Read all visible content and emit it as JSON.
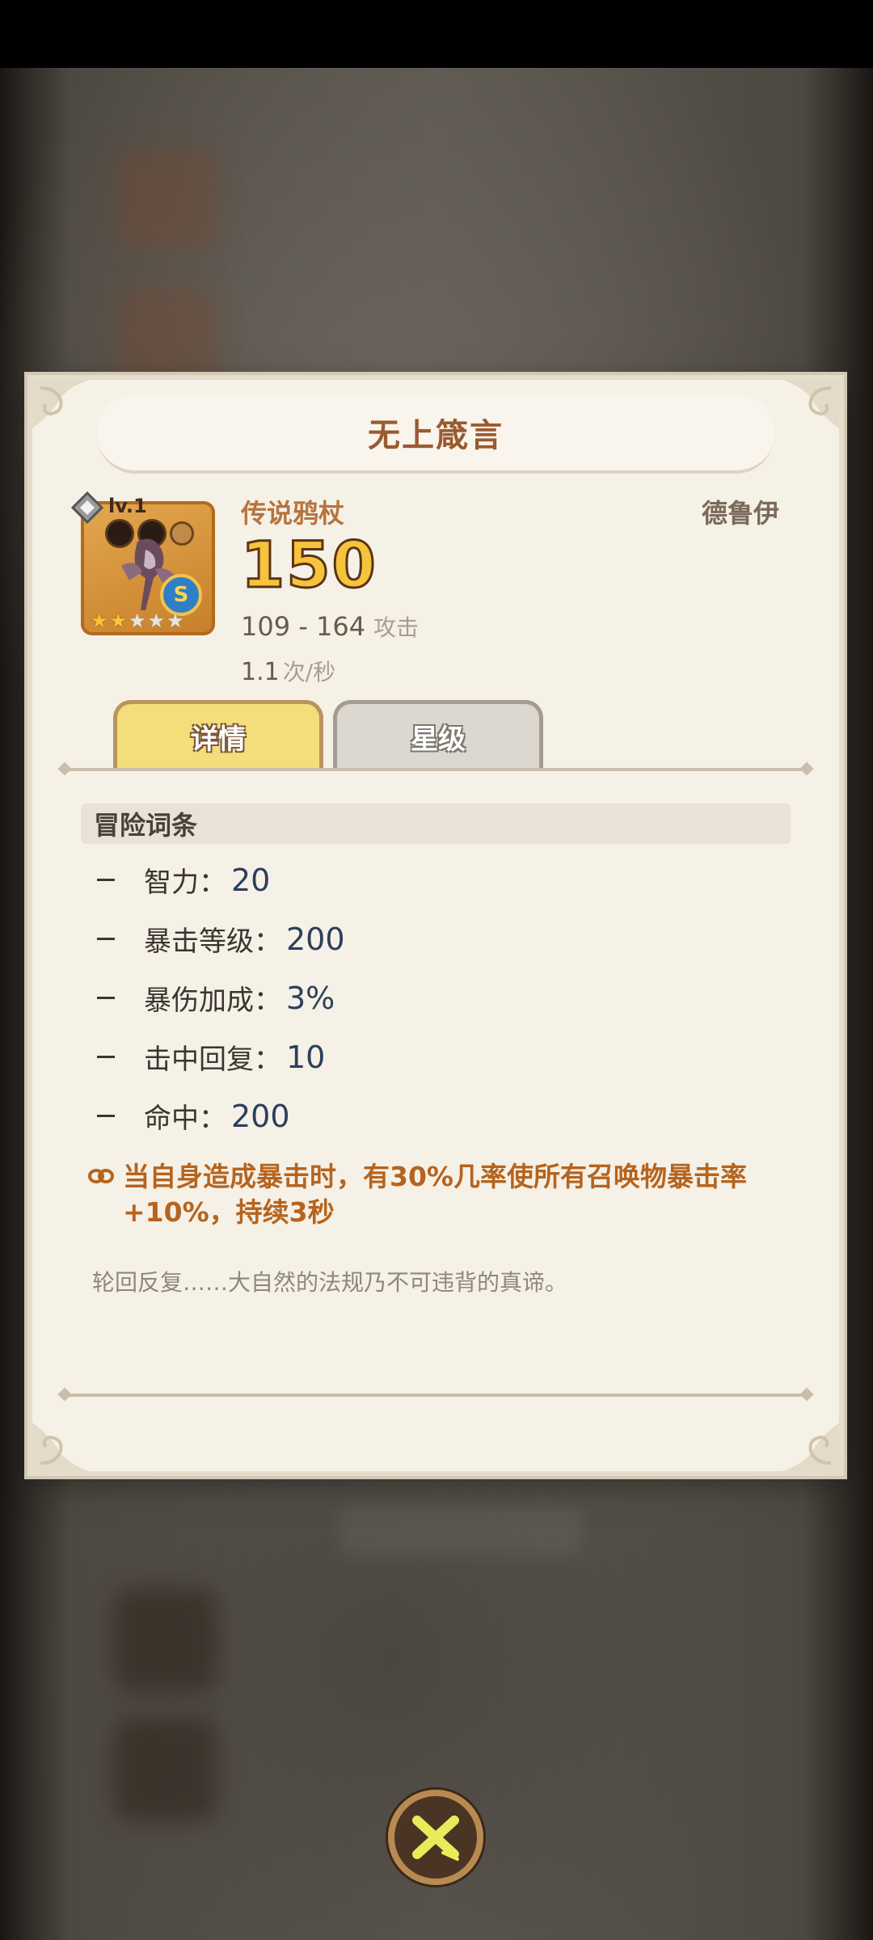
{
  "item": {
    "name": "无上箴言",
    "level": "lv.1",
    "type": "传说鸦杖",
    "class": "德鲁伊",
    "power": "150",
    "damage_range": "109 - 164",
    "damage_label": "攻击",
    "attack_speed": "1.1",
    "attack_speed_unit": "次/秒",
    "grade_badge": "S",
    "stars_filled": 2,
    "stars_total": 5
  },
  "tabs": [
    {
      "label": "详情",
      "active": true
    },
    {
      "label": "星级",
      "active": false
    }
  ],
  "details": {
    "section_title": "冒险词条",
    "stats": [
      {
        "name": "智力：",
        "value": "20"
      },
      {
        "name": "暴击等级：",
        "value": "200"
      },
      {
        "name": "暴伤加成：",
        "value": "3%"
      },
      {
        "name": "击中回复：",
        "value": "10"
      },
      {
        "name": "命中：",
        "value": "200"
      }
    ],
    "special_effect": "当自身造成暴击时，有30%几率使所有召唤物暴击率+10%，持续3秒",
    "lore": "轮回反复……大自然的法规乃不可违背的真谛。"
  },
  "colors": {
    "card_bg": "#f6f1e6",
    "title": "#9a5a30",
    "active_tab": "#f4de7c",
    "effect_text": "#b5641f"
  }
}
